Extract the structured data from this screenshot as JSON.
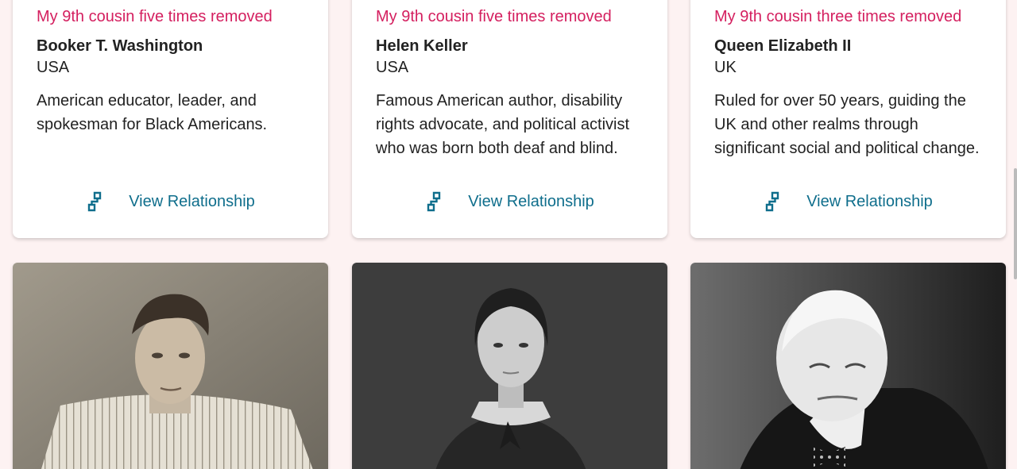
{
  "cards": [
    {
      "relationship": "My 9th cousin five times removed",
      "name": "Booker T. Washington",
      "country": "USA",
      "description": "American educator, leader, and spokesman for Black Americans.",
      "link": "View Relationship"
    },
    {
      "relationship": "My 9th cousin five times removed",
      "name": "Helen Keller",
      "country": "USA",
      "description": "Famous American author, disability rights advocate, and political activist who was born both deaf and blind.",
      "link": "View Relationship"
    },
    {
      "relationship": "My 9th cousin three times removed",
      "name": "Queen Elizabeth II",
      "country": "UK",
      "description": "Ruled for over 50 years, guiding the UK and other realms through significant social and political change.",
      "link": "View Relationship"
    }
  ],
  "icons": {
    "relationship_link": "relationship-tree-icon"
  },
  "colors": {
    "background": "#fdf2f2",
    "relationship_text": "#d41f5f",
    "link_text": "#0f6e8c"
  }
}
